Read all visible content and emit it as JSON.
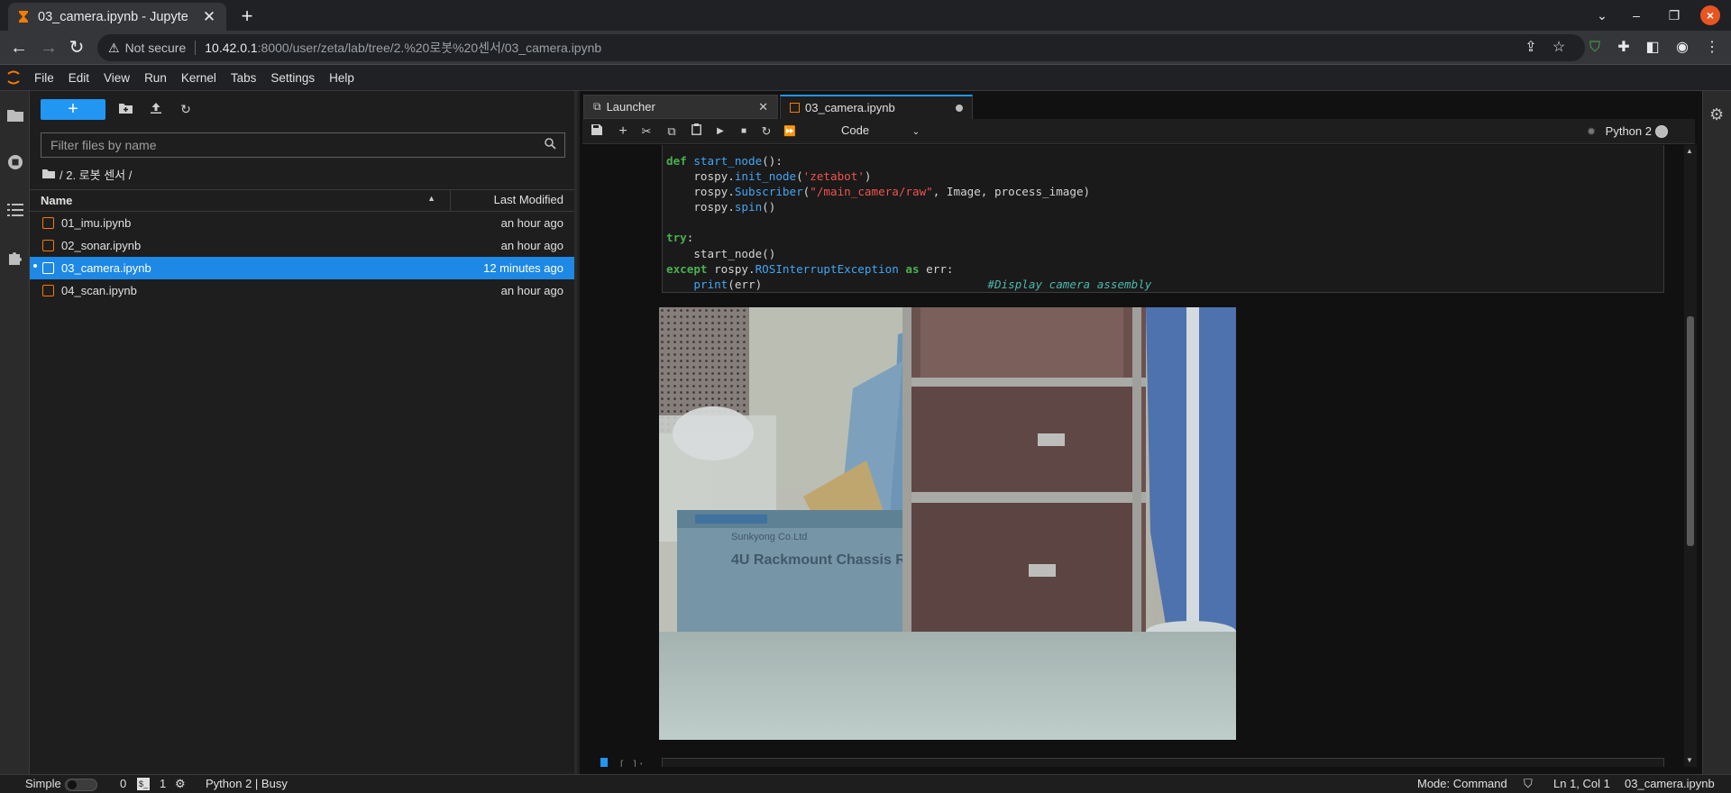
{
  "browser": {
    "tab_title": "03_camera.ipynb - Jupyte",
    "tab_close": "✕",
    "new_tab": "+",
    "security_label": "Not secure",
    "url_host": "10.42.0.1",
    "url_path": ":8000/user/zeta/lab/tree/2.%20로봇%20센서/03_camera.ipynb"
  },
  "menu": {
    "items": [
      "File",
      "Edit",
      "View",
      "Run",
      "Kernel",
      "Tabs",
      "Settings",
      "Help"
    ]
  },
  "filebrowser": {
    "new_label": "+",
    "filter_placeholder": "Filter files by name",
    "breadcrumb": "/ 2. 로봇 센서 /",
    "col_name": "Name",
    "col_modified": "Last Modified",
    "files": [
      {
        "name": "01_imu.ipynb",
        "modified": "an hour ago"
      },
      {
        "name": "02_sonar.ipynb",
        "modified": "an hour ago"
      },
      {
        "name": "03_camera.ipynb",
        "modified": "12 minutes ago"
      },
      {
        "name": "04_scan.ipynb",
        "modified": "an hour ago"
      }
    ]
  },
  "doc_tabs": [
    {
      "label": "Launcher"
    },
    {
      "label": "03_camera.ipynb"
    }
  ],
  "notebook": {
    "cell_type": "Code",
    "kernel_name": "Python 2",
    "prompt": "[ ]:"
  },
  "status": {
    "mode_label": "Simple",
    "count_a": "0",
    "count_b": "1",
    "kernel_status": "Python 2 | Busy",
    "mode": "Mode: Command",
    "cursor": "Ln 1, Col 1",
    "filename": "03_camera.ipynb"
  },
  "colors": {
    "accent": "#2196f3",
    "selected_row": "#1e88e5",
    "jupyter_orange": "#f57c00",
    "close_button": "#e95420"
  }
}
